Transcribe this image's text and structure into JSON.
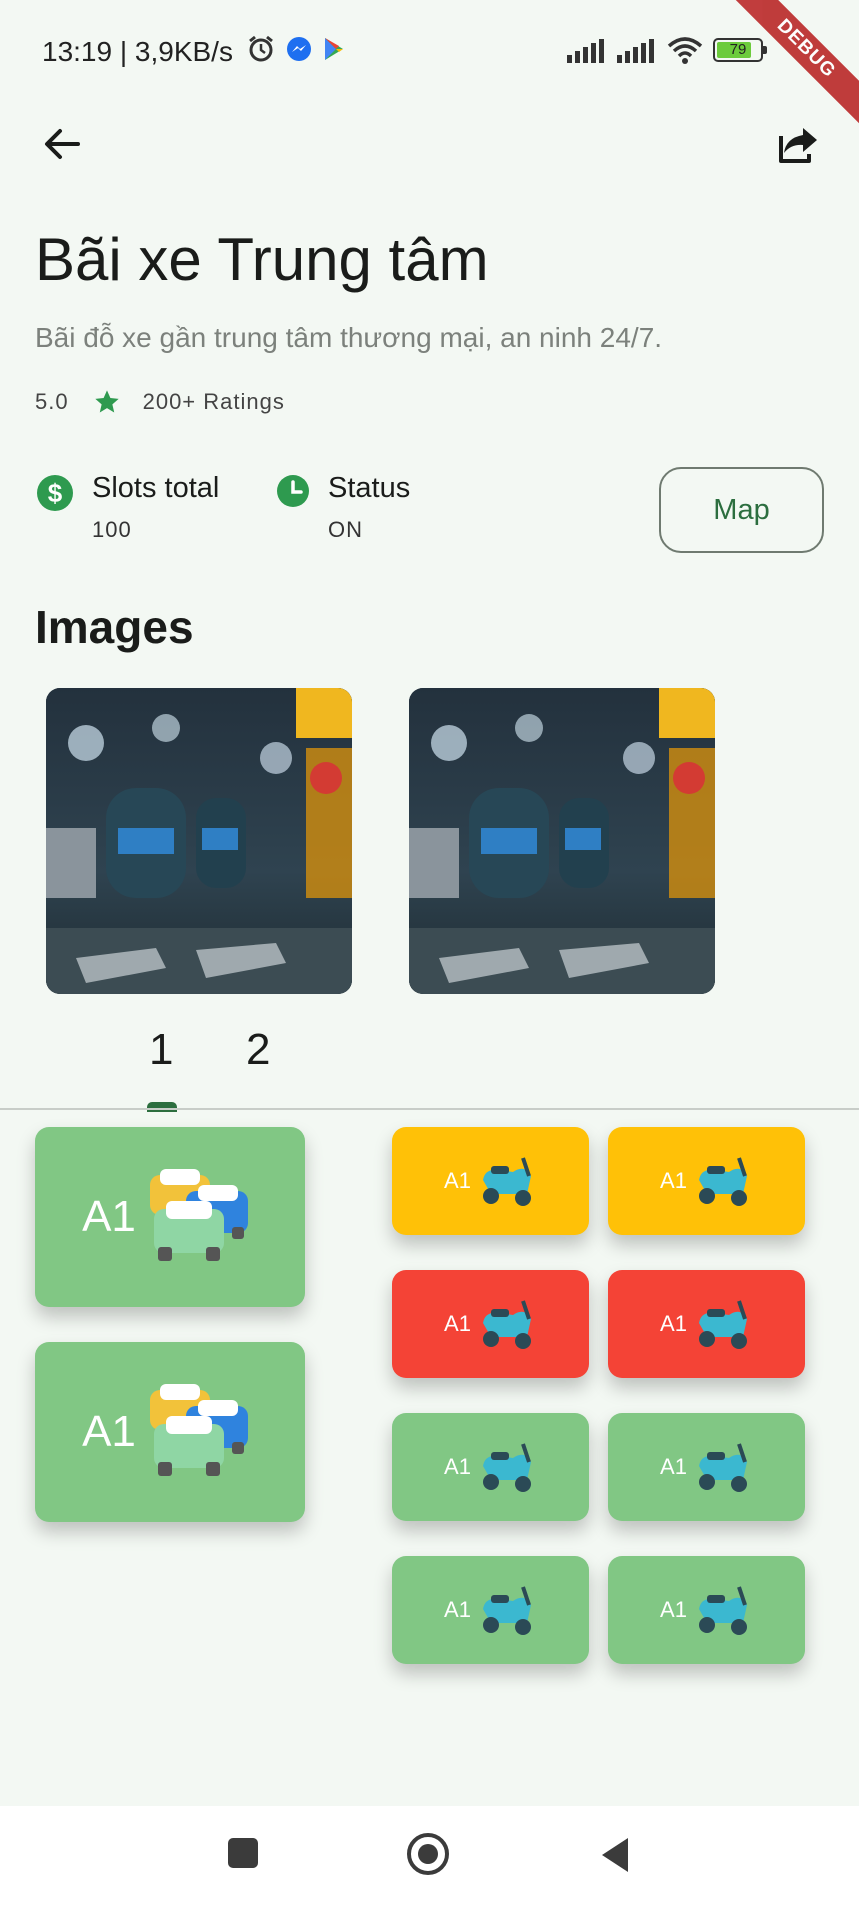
{
  "status_bar": {
    "time_speed": "13:19 | 3,9KB/s",
    "battery": "79",
    "debug_label": "DEBUG"
  },
  "app_bar": {
    "back_icon": "arrow-back-icon",
    "share_icon": "share-icon"
  },
  "parking": {
    "title": "Bãi xe Trung tâm",
    "description": "Bãi đỗ xe gần trung tâm thương mại, an ninh 24/7.",
    "rating": "5.0",
    "ratings_count": "200+ Ratings",
    "slots_total_label": "Slots total",
    "slots_total_value": "100",
    "status_label": "Status",
    "status_value": "ON",
    "map_button": "Map"
  },
  "images": {
    "section_title": "Images",
    "pages": [
      "1",
      "2"
    ],
    "current_page": 1
  },
  "slots": {
    "cars": [
      {
        "label": "A1",
        "status": "available"
      },
      {
        "label": "A1",
        "status": "available"
      }
    ],
    "bikes": [
      {
        "label": "A1",
        "status": "reserved"
      },
      {
        "label": "A1",
        "status": "reserved"
      },
      {
        "label": "A1",
        "status": "occupied"
      },
      {
        "label": "A1",
        "status": "occupied"
      },
      {
        "label": "A1",
        "status": "available"
      },
      {
        "label": "A1",
        "status": "available"
      },
      {
        "label": "A1",
        "status": "available"
      },
      {
        "label": "A1",
        "status": "available"
      }
    ]
  },
  "colors": {
    "available": "#81c784",
    "reserved": "#ffc107",
    "occupied": "#f44336",
    "accent": "#2c6e3f"
  },
  "nav_bar": {
    "recents_icon": "square-icon",
    "home_icon": "circle-home-icon",
    "back_icon": "triangle-back-icon"
  }
}
